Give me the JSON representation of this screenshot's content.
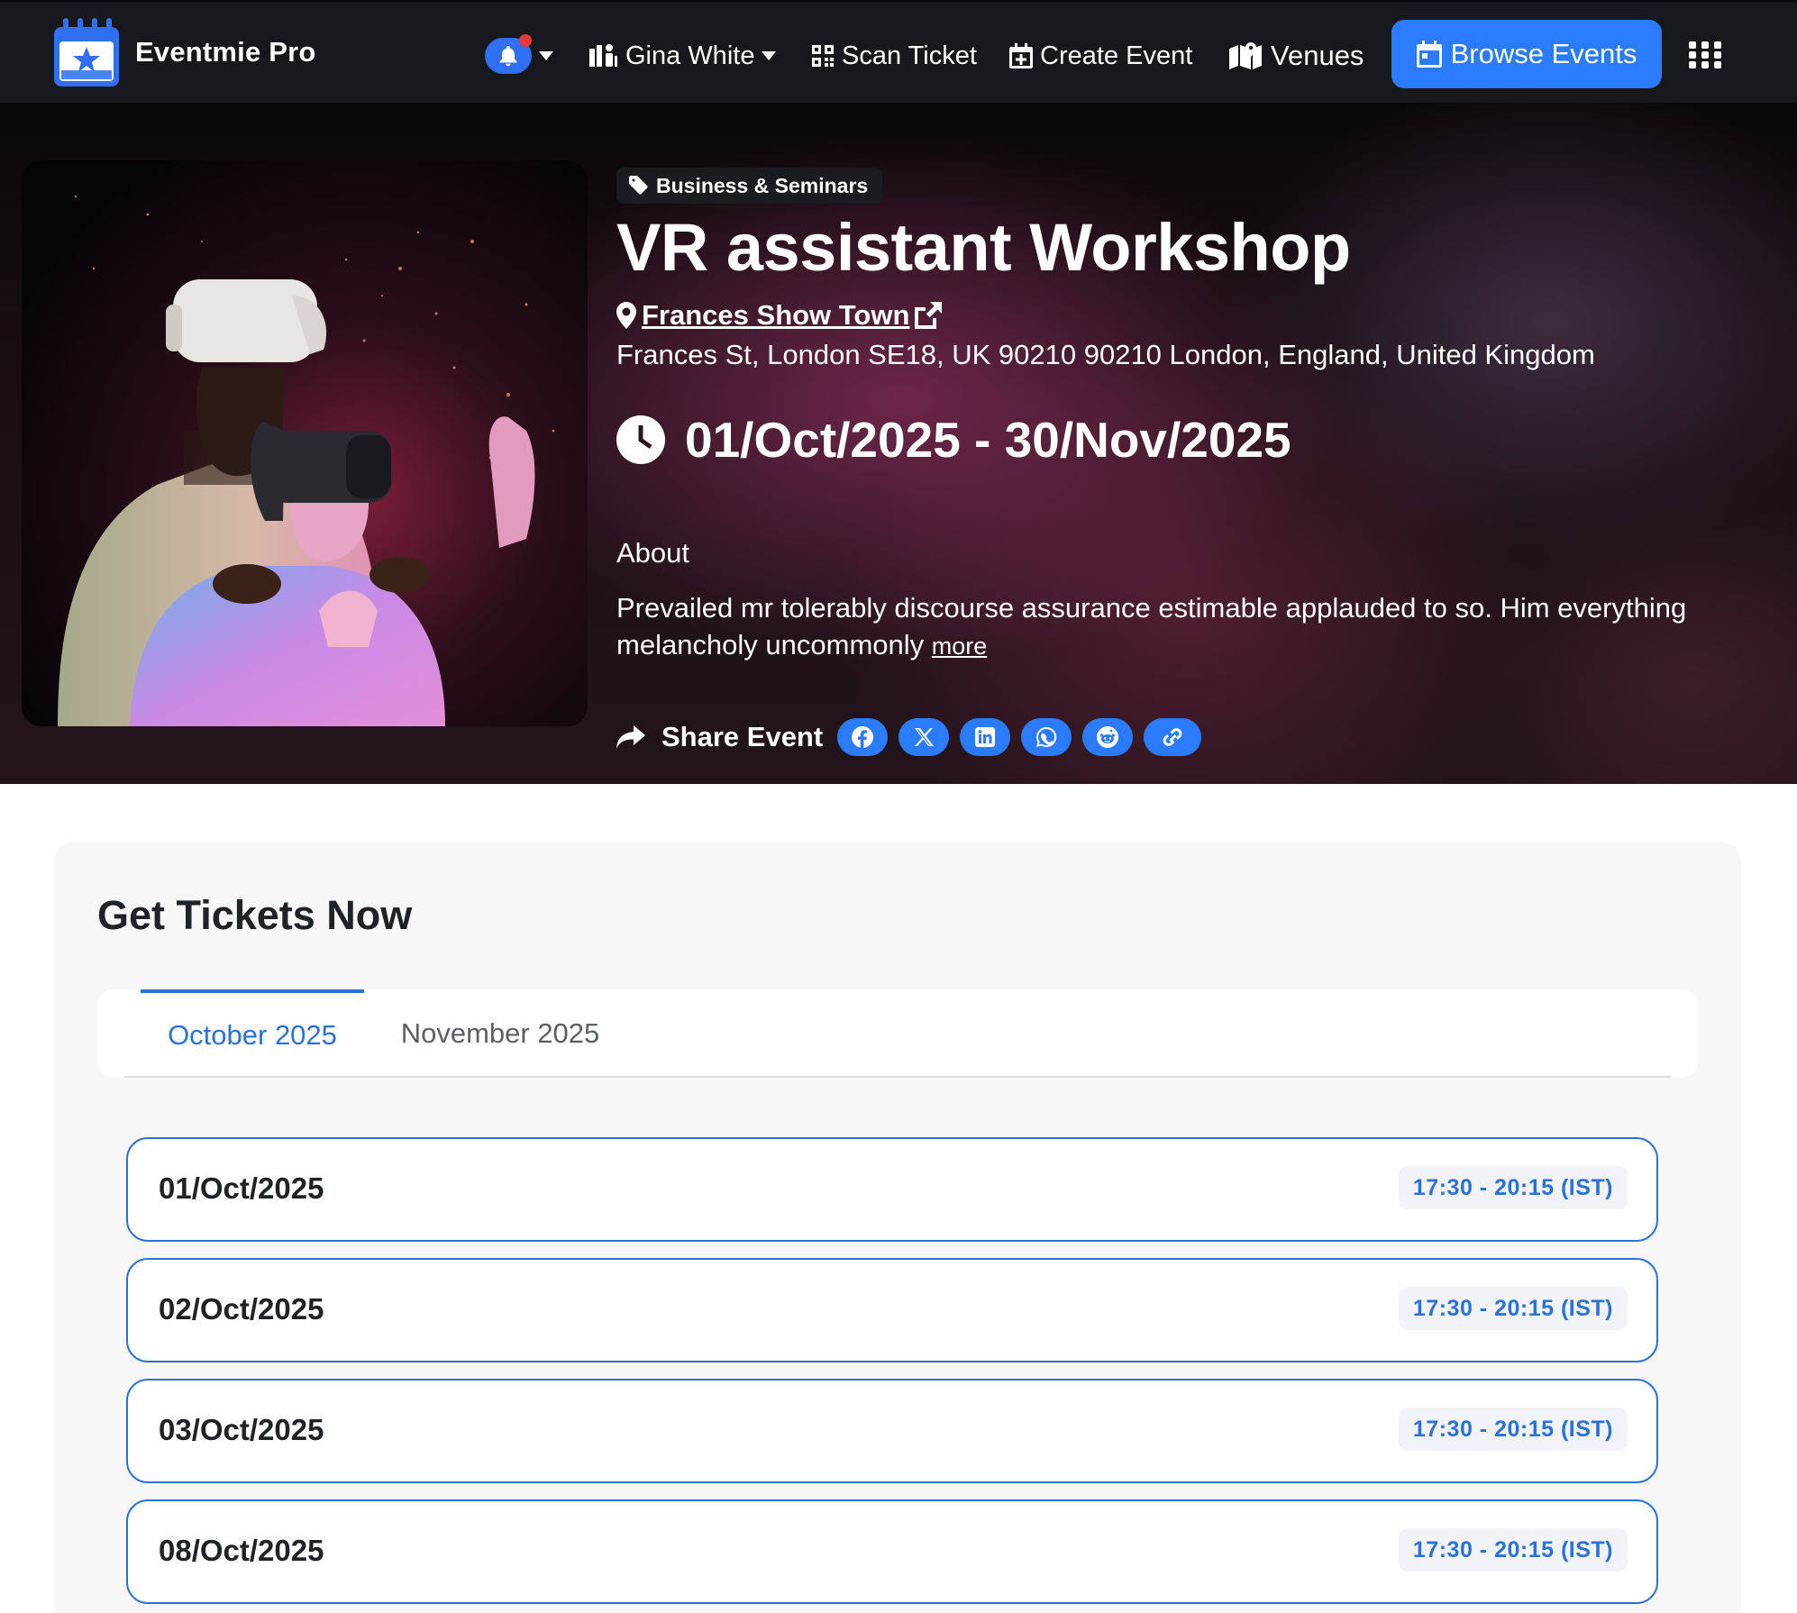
{
  "brand": {
    "name": "Eventmie Pro"
  },
  "navbar": {
    "user_name": "Gina White",
    "scan_ticket": "Scan Ticket",
    "create_event": "Create Event",
    "venues": "Venues",
    "browse_events": "Browse Events",
    "notification_count_dot": true,
    "accent": "#2b7bff"
  },
  "event": {
    "category": "Business & Seminars",
    "title": "VR assistant Workshop",
    "venue_name": "Frances Show Town",
    "address": "Frances St, London SE18, UK 90210 90210 London, England, United Kingdom",
    "date_range": "01/Oct/2025 - 30/Nov/2025",
    "about_heading": "About",
    "about_text": "Prevailed mr tolerably discourse assurance estimable applauded to so. Him everything melancholy uncommonly",
    "more_label": "more",
    "share_label": "Share Event",
    "share_icons": [
      "facebook-icon",
      "x-icon",
      "linkedin-icon",
      "whatsapp-icon",
      "reddit-icon",
      "link-icon"
    ]
  },
  "tickets": {
    "title": "Get Tickets Now",
    "tabs": [
      {
        "label": "October 2025",
        "active": true
      },
      {
        "label": "November 2025",
        "active": false
      }
    ],
    "dates": [
      {
        "date": "01/Oct/2025",
        "time": "17:30 - 20:15 (IST)"
      },
      {
        "date": "02/Oct/2025",
        "time": "17:30 - 20:15 (IST)"
      },
      {
        "date": "03/Oct/2025",
        "time": "17:30 - 20:15 (IST)"
      },
      {
        "date": "08/Oct/2025",
        "time": "17:30 - 20:15 (IST)"
      }
    ]
  },
  "colors": {
    "navbar_bg": "#16181b",
    "primary_blue": "#2b7bff",
    "tab_active": "#2b72d8",
    "notification_dot": "#e63a3a"
  }
}
